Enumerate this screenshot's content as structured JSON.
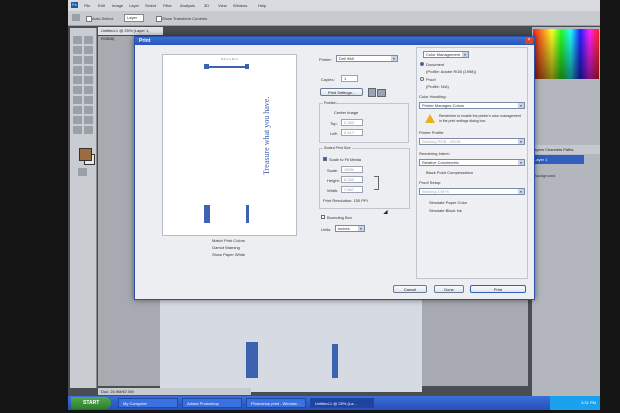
{
  "photoshop": {
    "menu": [
      "File",
      "Edit",
      "Image",
      "Layer",
      "Select",
      "Filter",
      "Analysis",
      "3D",
      "View",
      "Window",
      "Help"
    ],
    "options": {
      "auto_select": "Auto-Select:",
      "auto_select_value": "Layer",
      "show_transform": "Show Transform Controls"
    },
    "doc_tab": "Untitled-1 @ 25% (Layer 1, RGB/8)",
    "status": "Doc: 24.9M/67.0M",
    "panels": {
      "tab_label": "Layers  Channels  Paths",
      "active_row": "Layer 1",
      "row2": "Background"
    }
  },
  "taskbar": {
    "start": "START",
    "items": [
      "My Computer",
      "Adobe Photoshop",
      "Photoshop print - Window...",
      "Untitled-1 @ 25% (La..."
    ],
    "clock": "3:31 PM"
  },
  "print_dialog": {
    "title": "Print",
    "preview": {
      "dims": "8.5 in x 11 in",
      "vertical_text": "Treasure what you have.",
      "match_colors": "Match Print Colors",
      "gamut_warning": "Gamut Warning",
      "show_paper_white": "Show Paper White"
    },
    "printer": {
      "label": "Printer:",
      "value": "Dell 968"
    },
    "copies": {
      "label": "Copies:",
      "value": "1"
    },
    "print_settings": "Print Settings...",
    "position": {
      "title": "Position",
      "center_image": "Center Image",
      "top_label": "Top:",
      "top_value": "2.333",
      "left_label": "Left:",
      "left_value": "0.417"
    },
    "scaled": {
      "title": "Scaled Print Size",
      "scale_to_fit": "Scale to Fit Media",
      "scale_label": "Scale:",
      "scale_value": "100%",
      "height_label": "Height:",
      "height_value": "6.333",
      "width_label": "Width:",
      "width_value": "7.667",
      "resolution": "Print Resolution: 150 PPI"
    },
    "bounding_box": "Bounding Box",
    "units": {
      "label": "Units:",
      "value": "inches"
    },
    "color_management": {
      "dropdown": "Color Management",
      "document_label": "Document",
      "document_profile": "(Profile: Adobe RGB (1998))",
      "proof_label": "Proof",
      "proof_profile": "(Profile: N/A)",
      "color_handling_label": "Color Handling:",
      "color_handling_value": "Printer Manages Colors",
      "warning": "Remember to enable the printer's color management in the print settings dialog box.",
      "printer_profile_label": "Printer Profile:",
      "printer_profile_value": "Working RGB - sRGB",
      "rendering_intent_label": "Rendering Intent:",
      "rendering_intent_value": "Relative Colorimetric",
      "black_point": "Black Point Compensation",
      "proof_setup_label": "Proof Setup:",
      "proof_setup_value": "Working CMYK",
      "simulate_paper": "Simulate Paper Color",
      "simulate_black": "Simulate Black Ink"
    },
    "buttons": {
      "cancel": "Cancel",
      "done": "Done",
      "print": "Print"
    }
  },
  "colors": {
    "accent": "#2f5fbf",
    "bar": "#3c62b0",
    "taskbar": "#2450b8"
  }
}
